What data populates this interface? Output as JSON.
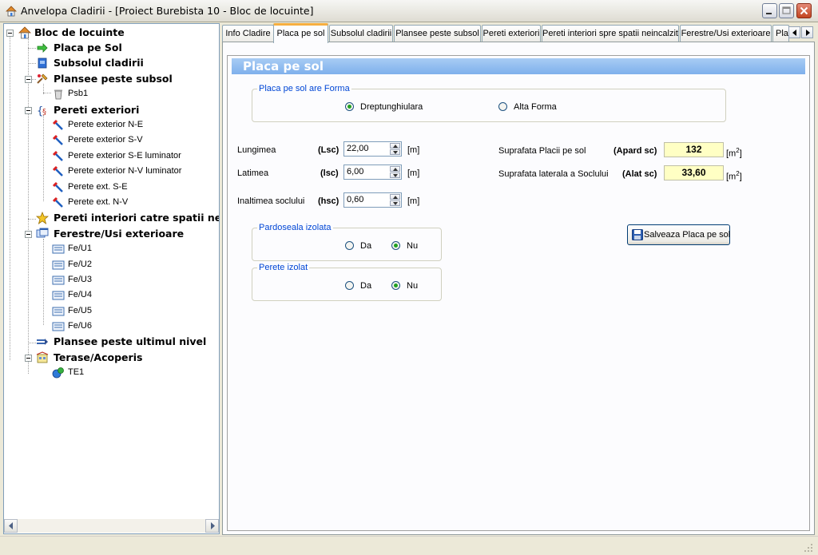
{
  "window": {
    "title": "Anvelopa Cladirii - [Proiect Burebista 10 - Bloc de locuinte]"
  },
  "tree": {
    "root": "Bloc de locuinte",
    "placa": "Placa pe Sol",
    "subsol": "Subsolul cladirii",
    "plansee_subsol": "Plansee peste subsol",
    "psb1": "Psb1",
    "pereti_ext": "Pereti exteriori",
    "pereti": [
      "Perete exterior N-E",
      "Perete exterior S-V",
      "Perete exterior S-E luminator",
      "Perete exterior  N-V luminator",
      "Perete ext. S-E",
      "Perete ext. N-V"
    ],
    "pereti_int": "Pereti interiori catre spatii nein",
    "ferestre": "Ferestre/Usi exterioare",
    "fe": [
      "Fe/U1",
      "Fe/U2",
      "Fe/U3",
      "Fe/U4",
      "Fe/U5",
      "Fe/U6"
    ],
    "plansee_ultim": "Plansee peste ultimul nivel",
    "terase": "Terase/Acoperis",
    "te1": "TE1"
  },
  "tabs": [
    "Info Cladire",
    "Placa pe sol",
    "Subsolul cladirii",
    "Plansee peste subsol",
    "Pereti exteriori",
    "Pereti interiori spre spatii neincalzite",
    "Ferestre/Usi exterioare",
    "Pla"
  ],
  "active_tab": "Placa pe sol",
  "form": {
    "banner": "Placa pe sol",
    "forma": {
      "title": "Placa pe sol are Forma",
      "opt1": "Dreptunghiulara",
      "opt2": "Alta Forma",
      "selected": "Dreptunghiulara"
    },
    "lungime": {
      "label": "Lungimea",
      "sym": "(Lsc)",
      "value": "22,00",
      "unit": "[m]"
    },
    "latime": {
      "label": "Latimea",
      "sym": "(lsc)",
      "value": "6,00",
      "unit": "[m]"
    },
    "inaltime": {
      "label": "Inaltimea soclului",
      "sym": "(hsc)",
      "value": "0,60",
      "unit": "[m]"
    },
    "suprafata": {
      "label": "Suprafata Placii pe sol",
      "sym": "(Apard sc)",
      "value": "132",
      "unit": "[m",
      "exp": "2",
      "close": "]"
    },
    "sup_laterala": {
      "label": "Suprafata laterala a Soclului",
      "sym": "(Alat sc)",
      "value": "33,60",
      "unit": "[m",
      "exp": "2",
      "close": "]"
    },
    "pardoseala": {
      "title": "Pardoseala izolata",
      "da": "Da",
      "nu": "Nu",
      "selected": "Nu"
    },
    "perete_izolat": {
      "title": "Perete izolat",
      "da": "Da",
      "nu": "Nu",
      "selected": "Nu"
    },
    "save_label": "Salveaza Placa pe sol"
  },
  "colors": {
    "banner": "#7fb0ec",
    "active_tab_accent": "#f6ae3f",
    "group_title": "#0046d5",
    "result_bg": "#ffffc4",
    "radio_dot": "#21a121"
  }
}
